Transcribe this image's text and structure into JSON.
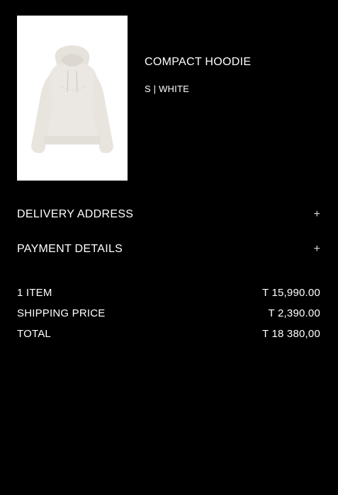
{
  "product": {
    "name": "COMPACT HOODIE",
    "variant": "S | WHITE"
  },
  "sections": {
    "delivery_label": "DELIVERY ADDRESS",
    "payment_label": "PAYMENT DETAILS",
    "expand_symbol": "+"
  },
  "summary": {
    "items_label": "1 ITEM",
    "items_value": "T 15,990.00",
    "shipping_label": "SHIPPING PRICE",
    "shipping_value": "T 2,390.00",
    "total_label": "TOTAL",
    "total_value": "T 18 380,00"
  },
  "colors": {
    "background": "#000000",
    "text": "#ffffff",
    "hoodie": "#ebe7e2"
  }
}
